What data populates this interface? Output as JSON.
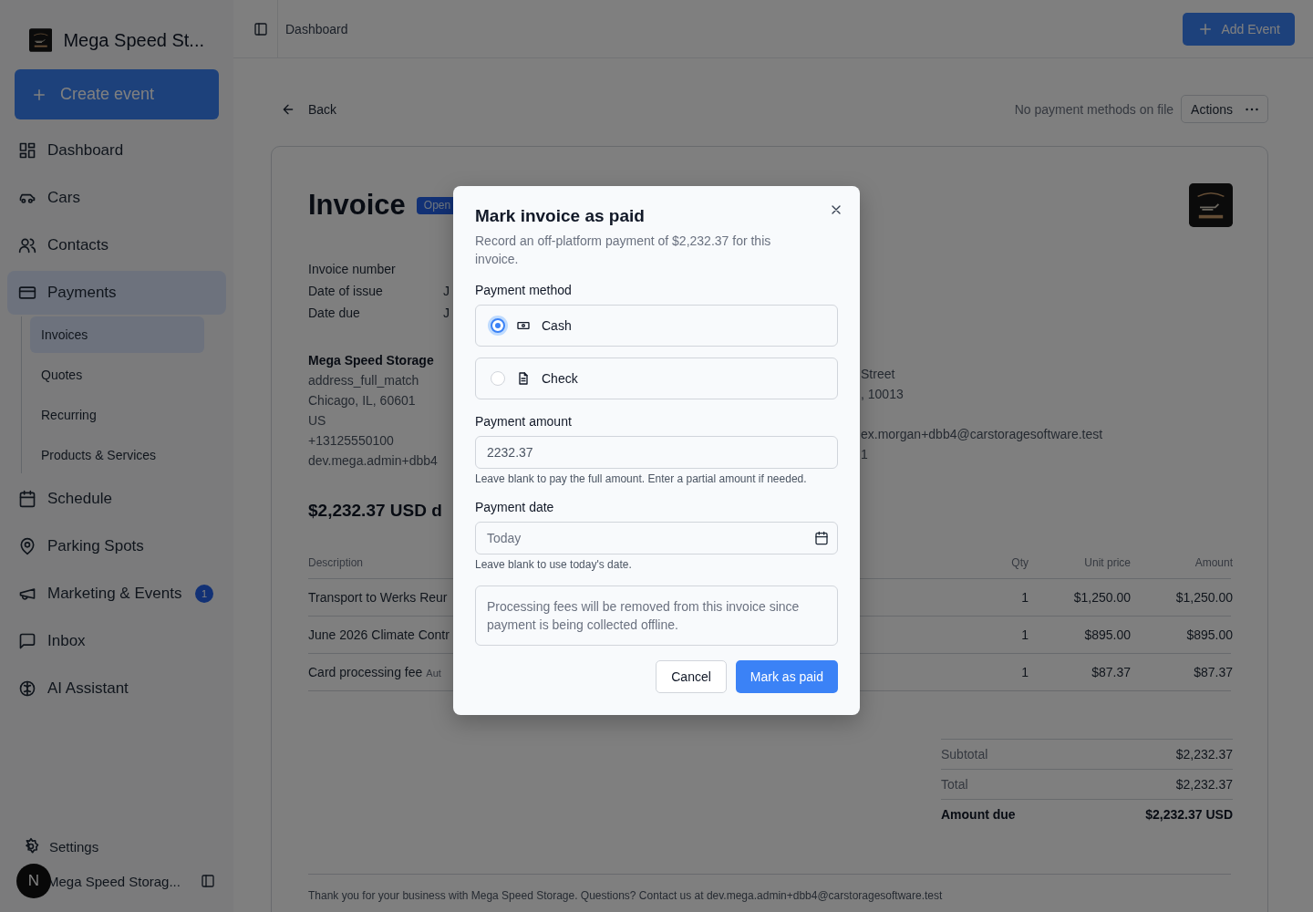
{
  "sidebar": {
    "brand": "Mega Speed St...",
    "create_button": "Create event",
    "items": [
      {
        "label": "Dashboard",
        "selected": false
      },
      {
        "label": "Cars",
        "selected": false
      },
      {
        "label": "Contacts",
        "selected": false
      },
      {
        "label": "Payments",
        "selected": true,
        "expanded": true,
        "children": [
          {
            "label": "Invoices",
            "selected": true
          },
          {
            "label": "Quotes",
            "selected": false
          },
          {
            "label": "Recurring",
            "selected": false
          },
          {
            "label": "Products & Services",
            "selected": false
          }
        ]
      },
      {
        "label": "Schedule",
        "selected": false
      },
      {
        "label": "Parking Spots",
        "selected": false
      },
      {
        "label": "Marketing & Events",
        "selected": false,
        "badge": "1"
      },
      {
        "label": "Inbox",
        "selected": false
      },
      {
        "label": "AI Assistant",
        "selected": false
      }
    ],
    "settings": "Settings",
    "user": {
      "initial": "N",
      "name": "Mega Speed Storag..."
    }
  },
  "topbar": {
    "breadcrumb": "Dashboard",
    "add_button": "Add Event"
  },
  "toolbar": {
    "back": "Back",
    "payment_note": "No payment methods on file",
    "actions": "Actions"
  },
  "invoice": {
    "title": "Invoice",
    "status": "Open",
    "meta": [
      {
        "label": "Invoice number"
      },
      {
        "label": "Date of issue",
        "value": "J"
      },
      {
        "label": "Date due",
        "value": "J"
      }
    ],
    "from": {
      "name": "Mega Speed Storage",
      "lines": [
        "address_full_match",
        "Chicago, IL, 60601",
        "US",
        "+13125550100",
        "dev.mega.admin+dbb4"
      ]
    },
    "bill_to": {
      "lines": [
        "Street",
        ", 10013",
        "ex.morgan+dbb4@carstoragesoftware.test",
        "1"
      ]
    },
    "amount_heading": "$2,232.37 USD d",
    "table": {
      "columns": [
        "Description",
        "Qty",
        "Unit price",
        "Amount"
      ],
      "rows": [
        {
          "description": "Transport to Werks Reur",
          "qty": "1",
          "unit_price": "$1,250.00",
          "amount": "$1,250.00"
        },
        {
          "description": "June 2026 Climate Contr",
          "qty": "1",
          "unit_price": "$895.00",
          "amount": "$895.00"
        },
        {
          "description": "Card processing fee",
          "note": "Aut",
          "qty": "1",
          "unit_price": "$87.37",
          "amount": "$87.37"
        }
      ]
    },
    "totals": [
      {
        "label": "Subtotal",
        "value": "$2,232.37",
        "kind": "normal"
      },
      {
        "label": "Total",
        "value": "$2,232.37",
        "kind": "normal"
      },
      {
        "label": "Amount due",
        "value": "$2,232.37 USD",
        "kind": "strong"
      }
    ],
    "footer": "Thank you for your business with Mega Speed Storage. Questions? Contact us at dev.mega.admin+dbb4@carstoragesoftware.test"
  },
  "modal": {
    "title": "Mark invoice as paid",
    "description": "Record an off-platform payment of $2,232.37 for this invoice.",
    "method_label": "Payment method",
    "methods": [
      {
        "label": "Cash",
        "selected": true
      },
      {
        "label": "Check",
        "selected": false
      }
    ],
    "amount_label": "Payment amount",
    "amount_value": "2232.37",
    "amount_help": "Leave blank to pay the full amount. Enter a partial amount if needed.",
    "date_label": "Payment date",
    "date_placeholder": "Today",
    "date_help": "Leave blank to use today's date.",
    "note": "Processing fees will be removed from this invoice since payment is being collected offline.",
    "cancel": "Cancel",
    "confirm": "Mark as paid"
  }
}
